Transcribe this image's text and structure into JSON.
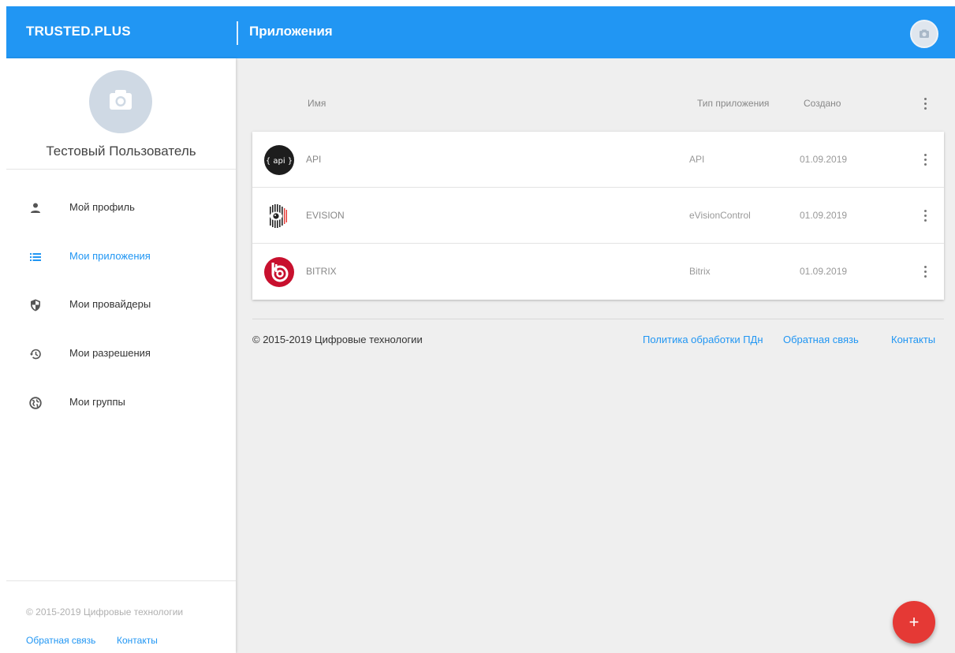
{
  "header": {
    "brand": "TRUSTED.PLUS",
    "title": "Приложения",
    "avatar_icon": "camera-icon"
  },
  "sidebar": {
    "user_name": "Тестовый Пользователь",
    "avatar_icon": "camera-icon",
    "items": [
      {
        "label": "Мой профиль",
        "icon": "person-icon",
        "active": false
      },
      {
        "label": "Мои приложения",
        "icon": "list-icon",
        "active": true
      },
      {
        "label": "Мои провайдеры",
        "icon": "shield-icon",
        "active": false
      },
      {
        "label": "Мои разрешения",
        "icon": "history-icon",
        "active": false
      },
      {
        "label": "Мои группы",
        "icon": "globe-icon",
        "active": false
      }
    ],
    "footer": {
      "copyright": "© 2015-2019 Цифровые технологии",
      "feedback": "Обратная связь",
      "contacts": "Контакты"
    }
  },
  "table": {
    "columns": {
      "name": "Имя",
      "type": "Тип приложения",
      "created": "Создано"
    },
    "rows": [
      {
        "name": "API",
        "type": "API",
        "created": "01.09.2019",
        "logo": "api-logo",
        "logo_text": "{ api }"
      },
      {
        "name": "EVISION",
        "type": "eVisionControl",
        "created": "01.09.2019",
        "logo": "evision-logo"
      },
      {
        "name": "BITRIX",
        "type": "Bitrix",
        "created": "01.09.2019",
        "logo": "bitrix-logo"
      }
    ]
  },
  "footer": {
    "copyright": "© 2015-2019 Цифровые технологии",
    "privacy": "Политика обработки ПДн",
    "feedback": "Обратная связь",
    "contacts": "Контакты"
  },
  "fab": {
    "label": "+"
  },
  "colors": {
    "primary": "#2196f3",
    "fab": "#e53935",
    "background": "#efefef"
  }
}
